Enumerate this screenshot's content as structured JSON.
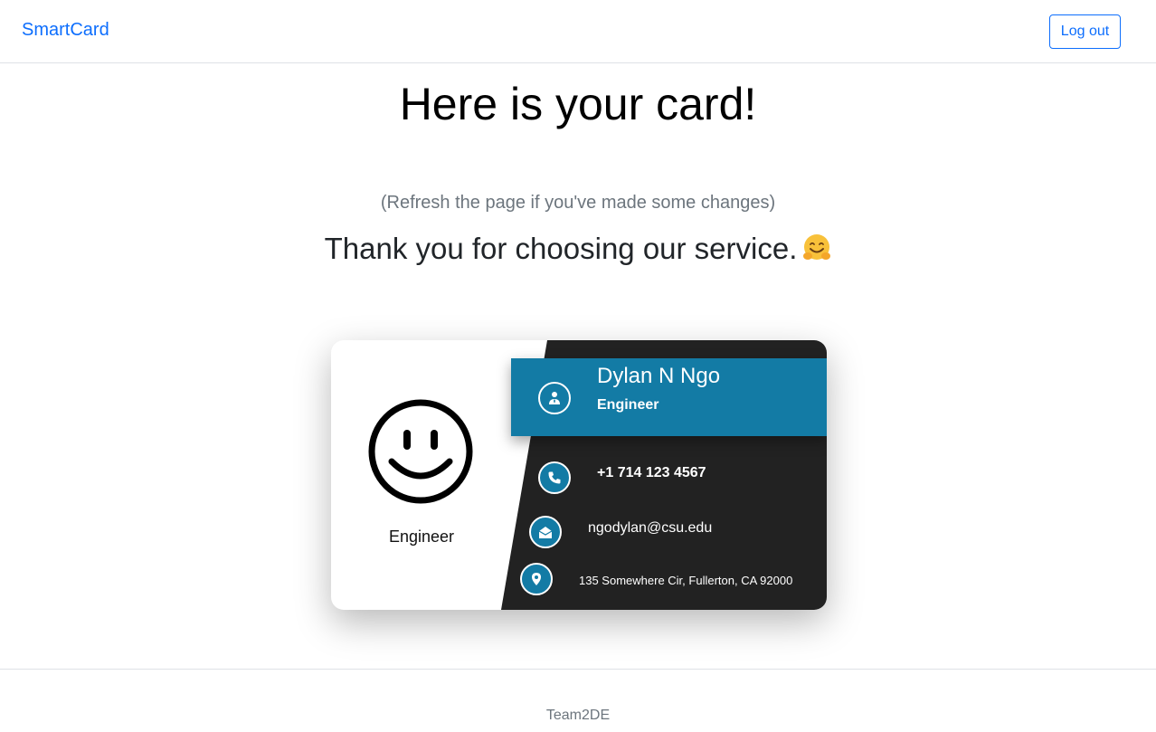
{
  "navbar": {
    "brand": "SmartCard",
    "logout_label": "Log out"
  },
  "main": {
    "title": "Here is your card!",
    "refresh_note": "(Refresh the page if you've made some changes)",
    "thanks": "Thank you for choosing our service."
  },
  "card": {
    "left_role": "Engineer",
    "name": "Dylan N Ngo",
    "role": "Engineer",
    "phone": "+1 714 123 4567",
    "email": "ngodylan@csu.edu",
    "address": "135 Somewhere Cir, Fullerton, CA 92000",
    "icons": [
      "user-tie-icon",
      "phone-icon",
      "envelope-open-icon",
      "map-marker-icon"
    ]
  },
  "footer": {
    "text": "Team2DE"
  },
  "colors": {
    "brand": "#0d6efd",
    "banner": "#137ba5",
    "card_dark": "#222222",
    "muted": "#6c757d"
  }
}
